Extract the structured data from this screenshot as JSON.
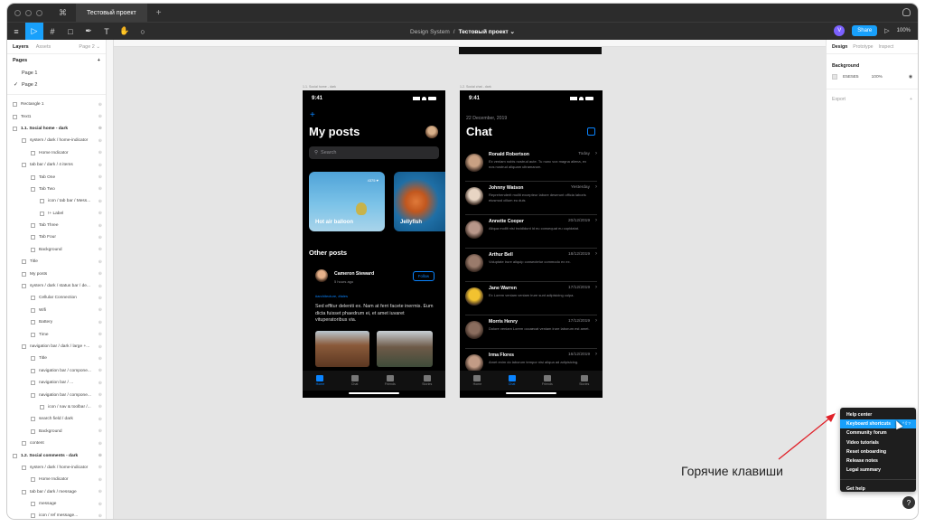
{
  "window": {
    "tab_title": "Тестовый проект",
    "figma_logo": "⌘"
  },
  "toolbar": {
    "breadcrumb_project": "Design System",
    "breadcrumb_sep": "/",
    "breadcrumb_file": "Тестовый проект ⌄",
    "avatar_letter": "V",
    "share_label": "Share",
    "play_icon": "▷",
    "zoom": "100%"
  },
  "left_panel": {
    "tabs": [
      "Layers",
      "Assets"
    ],
    "page_selector": "Page 2 ⌄",
    "pages_heading": "Pages",
    "pages": [
      {
        "label": "Page 1",
        "active": false
      },
      {
        "label": "Page 2",
        "active": true
      }
    ],
    "layers": [
      {
        "label": "Rectangle 1",
        "indent": 0,
        "bold": false
      },
      {
        "label": "Text1",
        "indent": 0,
        "bold": false
      },
      {
        "label": "1.1. Social home - dark",
        "indent": 0,
        "bold": true
      },
      {
        "label": "system / dark / home-indicator",
        "indent": 1,
        "bold": false
      },
      {
        "label": "Home Indicator",
        "indent": 2,
        "bold": false
      },
      {
        "label": "tab bar / dark / 4 items",
        "indent": 1,
        "bold": false
      },
      {
        "label": "Tab One",
        "indent": 2,
        "bold": false
      },
      {
        "label": "Tab Two",
        "indent": 2,
        "bold": false
      },
      {
        "label": "icon / tab bar / Mess...",
        "indent": 3,
        "bold": false
      },
      {
        "label": "!+ Label",
        "indent": 3,
        "bold": false
      },
      {
        "label": "Tab Three",
        "indent": 2,
        "bold": false
      },
      {
        "label": "Tab Four",
        "indent": 2,
        "bold": false
      },
      {
        "label": "Background",
        "indent": 2,
        "bold": false
      },
      {
        "label": "Title",
        "indent": 1,
        "bold": false
      },
      {
        "label": "My posts",
        "indent": 1,
        "bold": false
      },
      {
        "label": "system / dark / status bar / de...",
        "indent": 1,
        "bold": false
      },
      {
        "label": "Cellular Connection",
        "indent": 2,
        "bold": false
      },
      {
        "label": "Wifi",
        "indent": 2,
        "bold": false
      },
      {
        "label": "Battery",
        "indent": 2,
        "bold": false
      },
      {
        "label": "Time",
        "indent": 2,
        "bold": false
      },
      {
        "label": "navigation bar / dark / large +...",
        "indent": 1,
        "bold": false
      },
      {
        "label": "Title",
        "indent": 2,
        "bold": false
      },
      {
        "label": "navigation bar / compone...",
        "indent": 2,
        "bold": false
      },
      {
        "label": "navigation bar / ...",
        "indent": 2,
        "bold": false
      },
      {
        "label": "navigation bar / compone...",
        "indent": 2,
        "bold": false
      },
      {
        "label": "icon / nav & toolbar /...",
        "indent": 3,
        "bold": false
      },
      {
        "label": "search field / dark",
        "indent": 2,
        "bold": false
      },
      {
        "label": "Background",
        "indent": 2,
        "bold": false
      },
      {
        "label": "content",
        "indent": 1,
        "bold": false
      },
      {
        "label": "1.2. Social comments - dark",
        "indent": 0,
        "bold": true
      },
      {
        "label": "system / dark / home-indicator",
        "indent": 1,
        "bold": false
      },
      {
        "label": "Home Indicator",
        "indent": 2,
        "bold": false
      },
      {
        "label": "tab bar / dark / message",
        "indent": 1,
        "bold": false
      },
      {
        "label": "message",
        "indent": 2,
        "bold": false
      },
      {
        "label": "icon / ref message...",
        "indent": 2,
        "bold": false
      }
    ]
  },
  "canvas": {
    "frame1_label": "1.1. Social home - dark",
    "frame2_label": "1.2. Social chat - dark",
    "posts_phone": {
      "time": "9:41",
      "title": "My posts",
      "search_placeholder": "Search",
      "cards": [
        {
          "label": "Hot air balloon",
          "likes": "4375"
        },
        {
          "label": "Jellyfish",
          "likes": ""
        }
      ],
      "section_title": "Other posts",
      "author": "Cameron Steward",
      "author_time": "5 hours ago",
      "follow_label": "Follow",
      "tags": "#architecture, #tales",
      "post_text": "Sed effitur deleniti ex. Nam at ferri facete inermis. Eum dicta fuisset phaedrum ei, et amet iuvaret vituperatoribus via."
    },
    "chat_phone": {
      "time": "9:41",
      "date": "22 December, 2019",
      "title": "Chat",
      "chats": [
        {
          "name": "Ronald Robertson",
          "date": "Today",
          "message": "Ex veniam nobis nostrud aute. Tu nunc vox magna aliena, ex nos nostrud aliquam ultramarum.",
          "avatar": "#c9a183"
        },
        {
          "name": "Johnny Watson",
          "date": "Yesterday",
          "message": "Reprehenderit mollit excepteur labore deserunt officia laboris eiusmod cillum eu duis",
          "avatar": "#e8d5c4"
        },
        {
          "name": "Annette Cooper",
          "date": "20/12/2019",
          "message": "Aliqua mollit nisi incididunt id eu consequat eu cupidatat.",
          "avatar": "#b8978a"
        },
        {
          "name": "Arthur Bell",
          "date": "18/12/2019",
          "message": "Voluptate irure aliquip consectetur commodo ex ex.",
          "avatar": "#9a7b6b"
        },
        {
          "name": "Jane Warren",
          "date": "17/12/2019",
          "message": "Ex Lorem veniam veniam irure sunt adipisicing culpa.",
          "avatar": "#f2c230"
        },
        {
          "name": "Morris Henry",
          "date": "17/12/2019",
          "message": "Dolore veniam Lorem occaecat veniam irure laborum est amet.",
          "avatar": "#8a6d5e"
        },
        {
          "name": "Irma Flores",
          "date": "16/12/2019",
          "message": "Amet enim do laborum tempor nisi aliqua ad adipisicing.",
          "avatar": "#c29c86"
        }
      ]
    },
    "tabbar_items": [
      "Home",
      "Chat",
      "Friends",
      "Stories"
    ]
  },
  "right_panel": {
    "tabs": [
      "Design",
      "Prototype",
      "Inspect"
    ],
    "background_heading": "Background",
    "bg_value": "E5E5E5",
    "bg_opacity": "100%",
    "export_label": "Export",
    "export_add": "+"
  },
  "help_menu": {
    "items": [
      {
        "label": "Help center",
        "shortcut": "",
        "highlighted": false
      },
      {
        "label": "Keyboard shortcuts",
        "shortcut": "^⇧?",
        "highlighted": true
      },
      {
        "label": "Community forum",
        "shortcut": "",
        "highlighted": false
      },
      {
        "label": "Video tutorials",
        "shortcut": "",
        "highlighted": false
      },
      {
        "label": "Reset onboarding",
        "shortcut": "",
        "highlighted": false
      },
      {
        "label": "Release notes",
        "shortcut": "",
        "highlighted": false
      },
      {
        "label": "Legal summary",
        "shortcut": "",
        "highlighted": false
      }
    ],
    "footer": "Get help",
    "button": "?"
  },
  "annotation": {
    "text": "Горячие клавиши",
    "arrow_color": "#e0222a"
  }
}
